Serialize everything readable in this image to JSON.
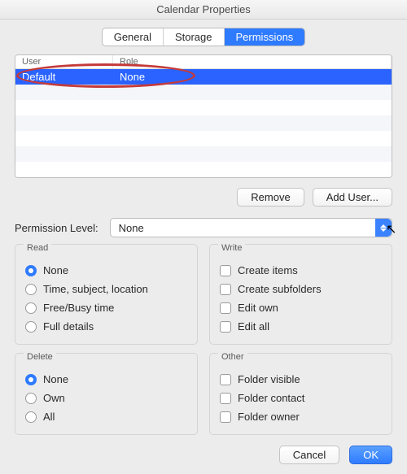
{
  "window": {
    "title": "Calendar Properties"
  },
  "tabs": {
    "general": "General",
    "storage": "Storage",
    "permissions": "Permissions"
  },
  "table": {
    "headers": {
      "user": "User",
      "role": "Role"
    },
    "rows": [
      {
        "user": "Default",
        "role": "None",
        "selected": true
      }
    ]
  },
  "buttons": {
    "remove": "Remove",
    "add_user": "Add User...",
    "cancel": "Cancel",
    "ok": "OK"
  },
  "perm_level": {
    "label": "Permission Level:",
    "value": "None"
  },
  "groups": {
    "read": {
      "legend": "Read",
      "options": {
        "none": "None",
        "time_subject": "Time, subject, location",
        "freebusy": "Free/Busy time",
        "full": "Full details"
      },
      "selected": "none"
    },
    "write": {
      "legend": "Write",
      "options": {
        "create_items": "Create items",
        "create_subfolders": "Create subfolders",
        "edit_own": "Edit own",
        "edit_all": "Edit all"
      }
    },
    "delete": {
      "legend": "Delete",
      "options": {
        "none": "None",
        "own": "Own",
        "all": "All"
      },
      "selected": "none"
    },
    "other": {
      "legend": "Other",
      "options": {
        "folder_visible": "Folder visible",
        "folder_contact": "Folder contact",
        "folder_owner": "Folder owner"
      }
    }
  }
}
